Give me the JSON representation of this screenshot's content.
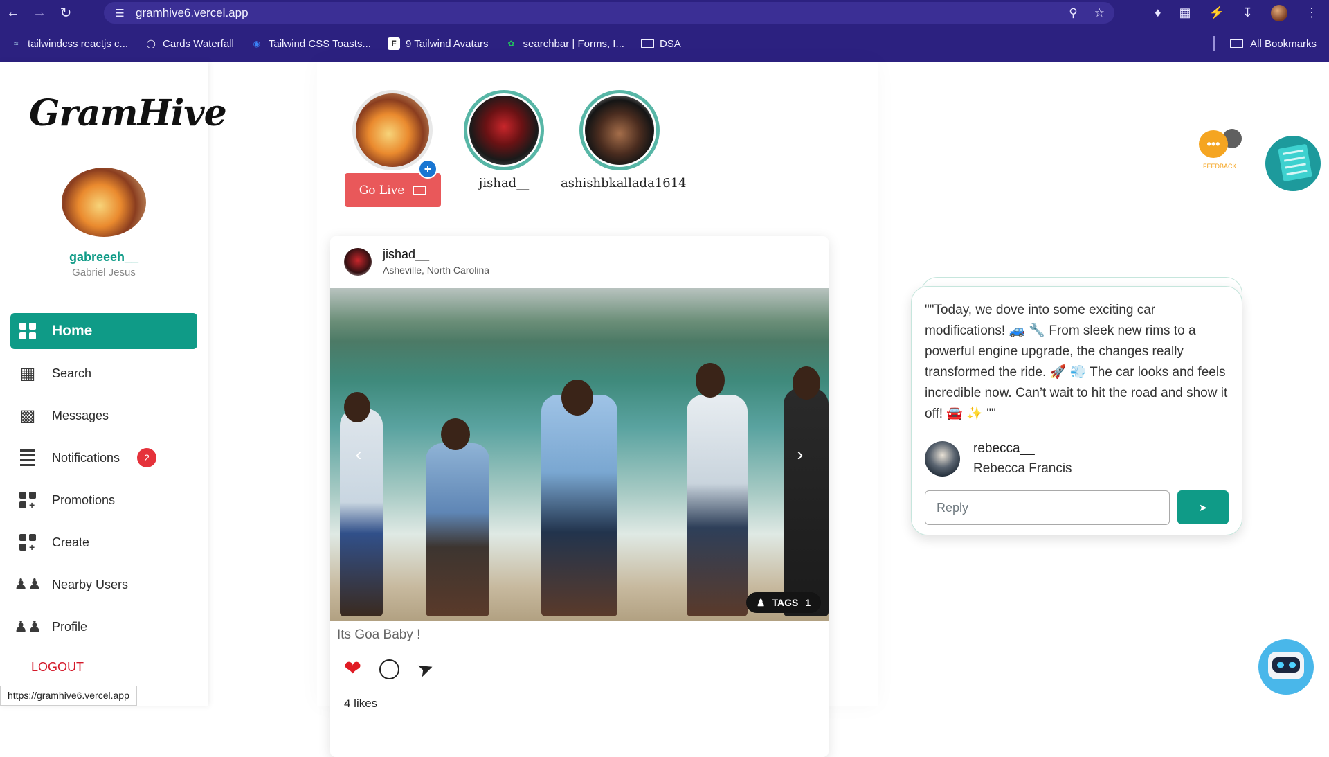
{
  "browser": {
    "url": "gramhive6.vercel.app",
    "bookmarks": [
      {
        "label": "tailwindcss reactjs c...",
        "icon": "tailwind-icon"
      },
      {
        "label": "Cards Waterfall",
        "icon": "globe-icon"
      },
      {
        "label": "Tailwind CSS Toasts...",
        "icon": "flowbite-icon"
      },
      {
        "label": "9 Tailwind Avatars",
        "icon": "f-icon"
      },
      {
        "label": "searchbar | Forms, I...",
        "icon": "leaf-icon"
      },
      {
        "label": "DSA",
        "icon": "folder-icon"
      }
    ],
    "all_bookmarks": "All Bookmarks",
    "status_url": "https://gramhive6.vercel.app"
  },
  "sidebar": {
    "logo": "GramHive",
    "username": "gabreeeh__",
    "fullname": "Gabriel Jesus",
    "items": [
      {
        "label": "Home",
        "icon": "grid-icon"
      },
      {
        "label": "Search",
        "icon": "cube-icon"
      },
      {
        "label": "Messages",
        "icon": "chat-icon"
      },
      {
        "label": "Notifications",
        "icon": "list-icon",
        "badge": "2"
      },
      {
        "label": "Promotions",
        "icon": "grid-plus-icon"
      },
      {
        "label": "Create",
        "icon": "grid-plus-icon"
      },
      {
        "label": "Nearby Users",
        "icon": "users-icon"
      },
      {
        "label": "Profile",
        "icon": "users-icon"
      }
    ],
    "logout": "LOGOUT"
  },
  "stories": {
    "go_live": "Go Live",
    "users": [
      {
        "name": "jishad__"
      },
      {
        "name": "ashishbkallada1614"
      }
    ]
  },
  "post": {
    "username": "jishad__",
    "location": "Asheville, North Carolina",
    "tags_label": "TAGS",
    "tags_count": "1",
    "caption": "Its Goa Baby !",
    "likes": "4 likes"
  },
  "feedback": {
    "label": "FEEDBACK"
  },
  "note": {
    "text": "\"\"Today, we dove into some exciting car modifications! 🚙 🔧 From sleek new rims to a powerful engine upgrade, the changes really transformed the ride. 🚀 💨 The car looks and feels incredible now. Can’t wait to hit the road and show it off! 🚘 ✨ \"\"",
    "username": "rebecca__",
    "fullname": "Rebecca Francis",
    "reply_placeholder": "Reply"
  },
  "colors": {
    "chrome": "#2c2180",
    "accent": "#0f9b87",
    "badge": "#e5323b",
    "golive": "#e9585a"
  }
}
